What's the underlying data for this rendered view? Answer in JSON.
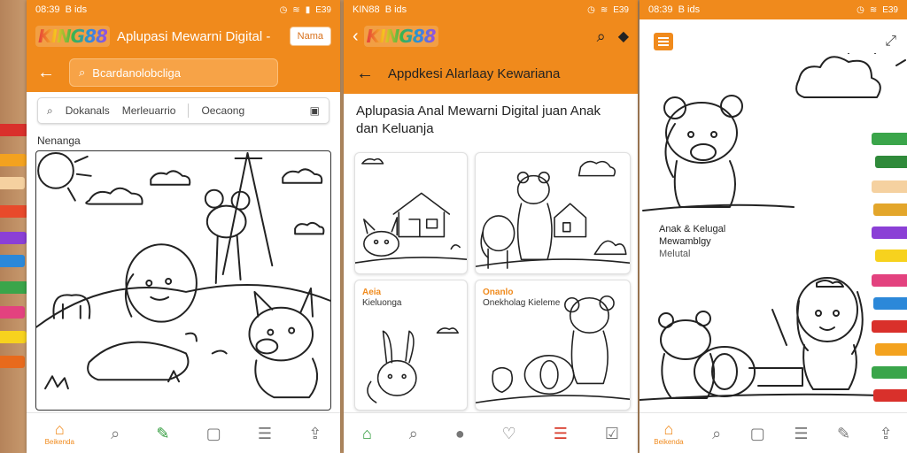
{
  "phone1": {
    "status": {
      "time": "08:39",
      "carrier": "B ids",
      "battery": "E39"
    },
    "logo": "KING88",
    "title": "Aplupasi Mewarni Digital -",
    "button": "Nama",
    "search_placeholder": "Bcardanolobcliga",
    "filters": [
      "Dokanals",
      "Merleuarrio",
      "Oecaong"
    ],
    "section_label": "Nenanga",
    "nav": [
      {
        "icon": "home-icon",
        "label": "Beikenda",
        "active": true
      },
      {
        "icon": "search-icon",
        "label": ""
      },
      {
        "icon": "palette-icon",
        "label": ""
      },
      {
        "icon": "gallery-icon",
        "label": ""
      },
      {
        "icon": "chat-icon",
        "label": ""
      },
      {
        "icon": "share-icon",
        "label": ""
      }
    ]
  },
  "phone2": {
    "status": {
      "time": "KIN88",
      "carrier": "B ids",
      "battery": "E39"
    },
    "logo": "KING88",
    "page_title": "Appdkesi Alarlaay Kewariana",
    "heading": "Aplupasia Anal Mewarni Digital juan Anak dan Keluanja",
    "cards": [
      {
        "tag": "",
        "label": ""
      },
      {
        "tag": "",
        "label": ""
      },
      {
        "tag": "Aeia",
        "label": "Kieluonga"
      },
      {
        "tag": "Onanlo",
        "label": "Onekholag Kieleme"
      }
    ],
    "nav": [
      {
        "icon": "home-icon",
        "label": ""
      },
      {
        "icon": "search-icon",
        "label": ""
      },
      {
        "icon": "info-icon",
        "label": ""
      },
      {
        "icon": "heart-icon",
        "label": ""
      },
      {
        "icon": "list-icon",
        "label": ""
      },
      {
        "icon": "edit-icon",
        "label": ""
      }
    ]
  },
  "phone3": {
    "status": {
      "time": "08:39",
      "carrier": "B ids",
      "battery": "E39"
    },
    "line1": "Anak & Kelugal",
    "line2": "Mewamblgy",
    "line3": "Melutal",
    "nav": [
      {
        "icon": "home-icon",
        "label": "Beikenda",
        "active": true
      },
      {
        "icon": "search-icon",
        "label": ""
      },
      {
        "icon": "gallery-icon",
        "label": ""
      },
      {
        "icon": "chat-icon",
        "label": ""
      },
      {
        "icon": "brush-icon",
        "label": ""
      },
      {
        "icon": "share-icon",
        "label": ""
      }
    ]
  },
  "colors": {
    "accent": "#f08a1c",
    "background": "#ffffff"
  }
}
